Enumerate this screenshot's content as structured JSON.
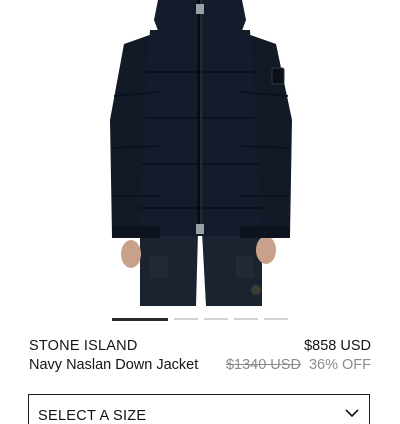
{
  "product": {
    "brand": "STONE ISLAND",
    "name": "Navy Naslan Down Jacket",
    "image_icon": "product-photo-navy-down-jacket"
  },
  "pricing": {
    "current": "$858 USD",
    "original": "$1340 USD",
    "discount": "36% OFF"
  },
  "carousel": {
    "total": 5,
    "active_index": 0
  },
  "size_selector": {
    "label": "SELECT A SIZE",
    "icon": "chevron-down-icon"
  },
  "colors": {
    "jacket_navy": "#141c2b",
    "text": "#151515",
    "muted": "#8c8c8c",
    "indicator_active": "#2a2a2a",
    "indicator_inactive": "#d3d3d3"
  }
}
